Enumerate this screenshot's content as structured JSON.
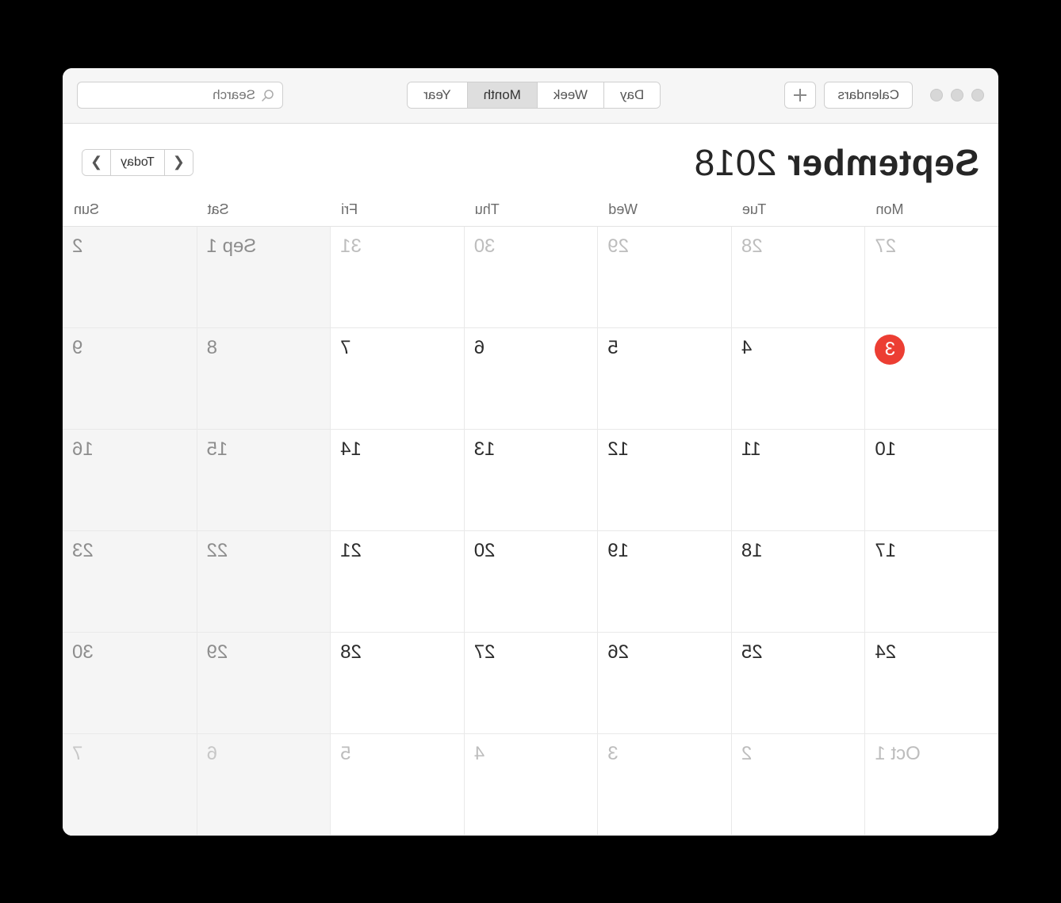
{
  "toolbar": {
    "calendars_label": "Calendars",
    "views": [
      "Day",
      "Week",
      "Month",
      "Year"
    ],
    "active_view": "Month",
    "search_placeholder": "Search"
  },
  "header": {
    "month": "September",
    "year": "2018",
    "today_label": "Today"
  },
  "weekdays": [
    "Mon",
    "Tue",
    "Wed",
    "Thu",
    "Fri",
    "Sat",
    "Sun"
  ],
  "cells": [
    {
      "label": "27",
      "other": true,
      "weekend": false,
      "today": false
    },
    {
      "label": "28",
      "other": true,
      "weekend": false,
      "today": false
    },
    {
      "label": "29",
      "other": true,
      "weekend": false,
      "today": false
    },
    {
      "label": "30",
      "other": true,
      "weekend": false,
      "today": false
    },
    {
      "label": "31",
      "other": true,
      "weekend": false,
      "today": false
    },
    {
      "label": "Sep 1",
      "other": false,
      "weekend": true,
      "today": false
    },
    {
      "label": "2",
      "other": false,
      "weekend": true,
      "today": false
    },
    {
      "label": "3",
      "other": false,
      "weekend": false,
      "today": true
    },
    {
      "label": "4",
      "other": false,
      "weekend": false,
      "today": false
    },
    {
      "label": "5",
      "other": false,
      "weekend": false,
      "today": false
    },
    {
      "label": "6",
      "other": false,
      "weekend": false,
      "today": false
    },
    {
      "label": "7",
      "other": false,
      "weekend": false,
      "today": false
    },
    {
      "label": "8",
      "other": false,
      "weekend": true,
      "today": false
    },
    {
      "label": "9",
      "other": false,
      "weekend": true,
      "today": false
    },
    {
      "label": "10",
      "other": false,
      "weekend": false,
      "today": false
    },
    {
      "label": "11",
      "other": false,
      "weekend": false,
      "today": false
    },
    {
      "label": "12",
      "other": false,
      "weekend": false,
      "today": false
    },
    {
      "label": "13",
      "other": false,
      "weekend": false,
      "today": false
    },
    {
      "label": "14",
      "other": false,
      "weekend": false,
      "today": false
    },
    {
      "label": "15",
      "other": false,
      "weekend": true,
      "today": false
    },
    {
      "label": "16",
      "other": false,
      "weekend": true,
      "today": false
    },
    {
      "label": "17",
      "other": false,
      "weekend": false,
      "today": false
    },
    {
      "label": "18",
      "other": false,
      "weekend": false,
      "today": false
    },
    {
      "label": "19",
      "other": false,
      "weekend": false,
      "today": false
    },
    {
      "label": "20",
      "other": false,
      "weekend": false,
      "today": false
    },
    {
      "label": "21",
      "other": false,
      "weekend": false,
      "today": false
    },
    {
      "label": "22",
      "other": false,
      "weekend": true,
      "today": false
    },
    {
      "label": "23",
      "other": false,
      "weekend": true,
      "today": false
    },
    {
      "label": "24",
      "other": false,
      "weekend": false,
      "today": false
    },
    {
      "label": "25",
      "other": false,
      "weekend": false,
      "today": false
    },
    {
      "label": "26",
      "other": false,
      "weekend": false,
      "today": false
    },
    {
      "label": "27",
      "other": false,
      "weekend": false,
      "today": false
    },
    {
      "label": "28",
      "other": false,
      "weekend": false,
      "today": false
    },
    {
      "label": "29",
      "other": false,
      "weekend": true,
      "today": false
    },
    {
      "label": "30",
      "other": false,
      "weekend": true,
      "today": false
    },
    {
      "label": "Oct 1",
      "other": true,
      "weekend": false,
      "today": false
    },
    {
      "label": "2",
      "other": true,
      "weekend": false,
      "today": false
    },
    {
      "label": "3",
      "other": true,
      "weekend": false,
      "today": false
    },
    {
      "label": "4",
      "other": true,
      "weekend": false,
      "today": false
    },
    {
      "label": "5",
      "other": true,
      "weekend": false,
      "today": false
    },
    {
      "label": "6",
      "other": true,
      "weekend": true,
      "today": false
    },
    {
      "label": "7",
      "other": true,
      "weekend": true,
      "today": false
    }
  ]
}
